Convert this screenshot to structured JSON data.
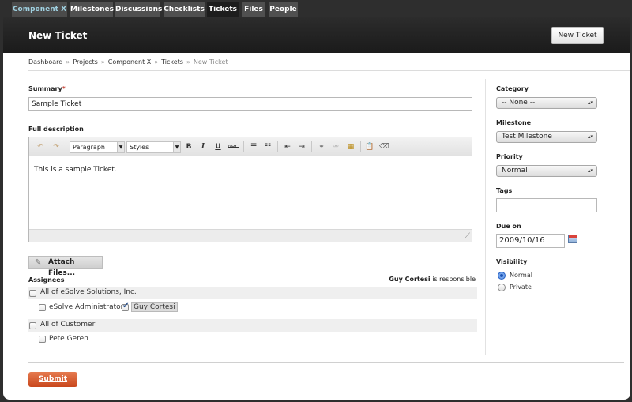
{
  "tabs": [
    "Component X",
    "Milestones",
    "Discussions",
    "Checklists",
    "Tickets",
    "Files",
    "People"
  ],
  "header": {
    "title": "New Ticket",
    "button_label": "New Ticket"
  },
  "breadcrumb": {
    "items": [
      "Dashboard",
      "Projects",
      "Component X",
      "Tickets"
    ],
    "current": "New Ticket",
    "separator": "»"
  },
  "form": {
    "summary_label": "Summary",
    "required_mark": "*",
    "summary_value": "Sample Ticket",
    "description_label": "Full description",
    "editor": {
      "format_select": "Paragraph",
      "styles_select": "Styles",
      "body": "This is a sample Ticket.",
      "icons": [
        "undo-icon",
        "redo-icon",
        "bold-icon",
        "italic-icon",
        "underline-icon",
        "strikethrough-icon",
        "bullet-list-icon",
        "numbered-list-icon",
        "outdent-icon",
        "indent-icon",
        "link-icon",
        "unlink-icon",
        "table-icon",
        "paste-icon",
        "eraser-icon"
      ],
      "bold_glyph": "B",
      "italic_glyph": "I",
      "underline_glyph": "U",
      "strike_glyph": "ABC"
    },
    "attach_label": "Attach Files...",
    "assignees_label": "Assignees",
    "responsible_name": "Guy Cortesi",
    "responsible_suffix": " is responsible",
    "groups": [
      {
        "name": "All of eSolve Solutions, Inc.",
        "checked": false,
        "members": [
          {
            "name": "eSolve Administrator",
            "checked": false
          },
          {
            "name": "Guy Cortesi",
            "checked": true
          }
        ]
      },
      {
        "name": "All of Customer",
        "checked": false,
        "members": [
          {
            "name": "Pete Geren",
            "checked": false
          }
        ]
      }
    ],
    "submit_label": "Submit"
  },
  "sidebar": {
    "category_label": "Category",
    "category_value": "-- None --",
    "milestone_label": "Milestone",
    "milestone_value": "Test Milestone",
    "priority_label": "Priority",
    "priority_value": "Normal",
    "tags_label": "Tags",
    "tags_value": "",
    "due_label": "Due on",
    "due_value": "2009/10/16",
    "visibility_label": "Visibility",
    "visibility_options": [
      "Normal",
      "Private"
    ],
    "visibility_selected": "Normal"
  },
  "colors": {
    "accent_tab": "#9fd0e0",
    "submit": "#d9582b",
    "radio_selected": "#2a62c3"
  }
}
